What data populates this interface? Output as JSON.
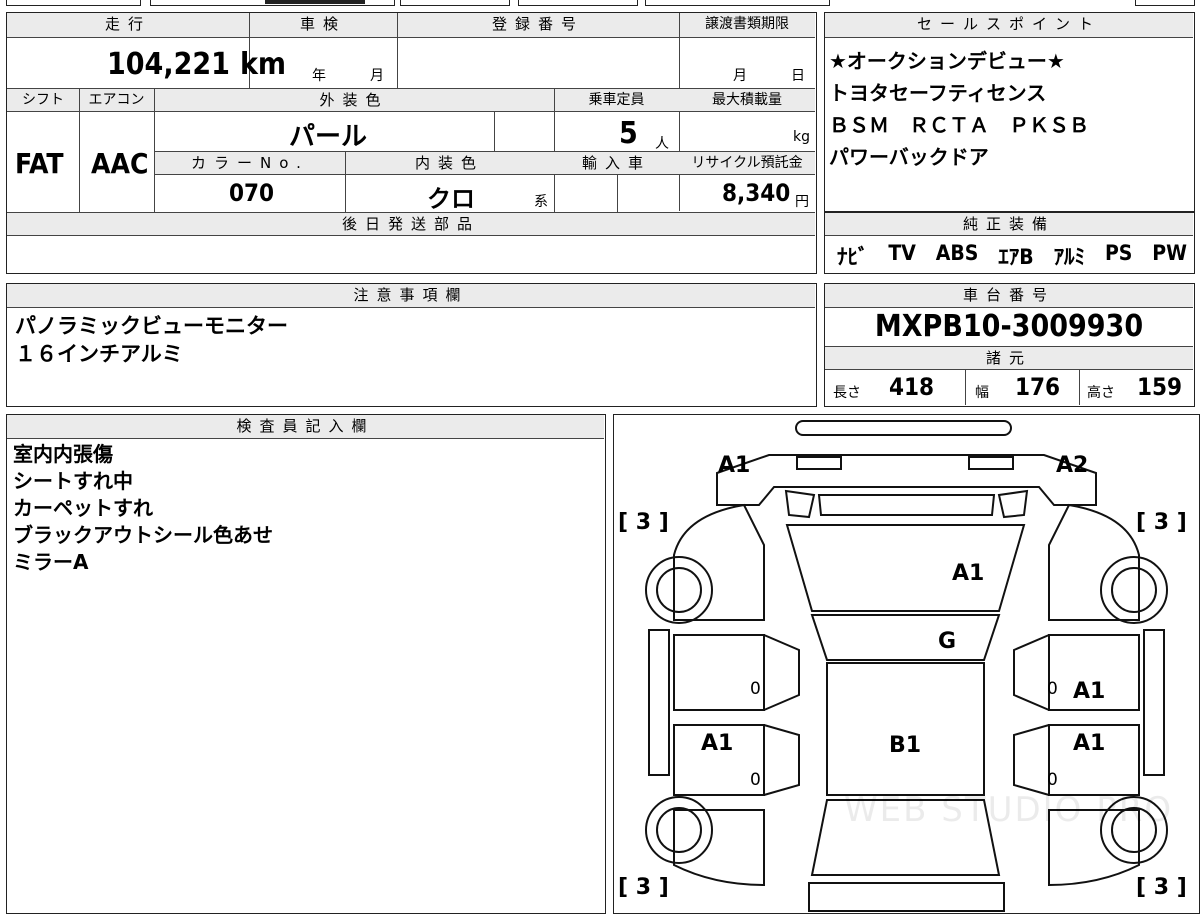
{
  "spec": {
    "mileage_label": "走行",
    "mileage_value": "104,221",
    "mileage_unit": "km",
    "inspection_label": "車検",
    "inspection_year": "年",
    "inspection_month": "月",
    "registration_label": "登録番号",
    "transfer_label": "譲渡書類期限",
    "transfer_month": "月",
    "transfer_day": "日",
    "shift_label": "シフト",
    "shift_value": "FAT",
    "ac_label": "エアコン",
    "ac_value": "AAC",
    "exterior_label": "外装色",
    "exterior_value": "パール",
    "capacity_label": "乗車定員",
    "capacity_value": "5",
    "capacity_unit": "人",
    "max_load_label": "最大積載量",
    "max_load_unit": "kg",
    "color_no_label": "カラーNo.",
    "color_no_value": "070",
    "interior_label": "内装色",
    "interior_value": "クロ",
    "interior_suffix": "系",
    "import_label": "輸入車",
    "recycle_label": "リサイクル預託金",
    "recycle_value": "8,340",
    "recycle_unit": "円",
    "later_parts_label": "後日発送部品"
  },
  "sales_points": {
    "label": "セールスポイント",
    "lines": [
      "★オークションデビュー★",
      "トヨタセーフティセンス",
      "ＢＳＭ　ＲＣＴＡ　ＰＫＳＢ",
      "パワーバックドア"
    ]
  },
  "equipment": {
    "label": "純正装備",
    "items": [
      "ﾅﾋﾞ",
      "TV",
      "ABS",
      "ｴｱB",
      "ｱﾙﾐ",
      "PS",
      "PW"
    ]
  },
  "notes": {
    "label": "注意事項欄",
    "lines": [
      "パノラミックビューモニター",
      "１６インチアルミ"
    ]
  },
  "chassis": {
    "label": "車台番号",
    "value": "MXPB10-3009930",
    "spec_label": "諸元",
    "length_label": "長さ",
    "length_value": "418",
    "width_label": "幅",
    "width_value": "176",
    "height_label": "高さ",
    "height_value": "159"
  },
  "inspector": {
    "label": "検査員記入欄",
    "lines": [
      "室内内張傷",
      "シートすれ中",
      "カーペットすれ",
      "ブラックアウトシール色あせ",
      "ミラーA"
    ]
  },
  "diagram": {
    "marks": [
      "A1",
      "A2",
      "A1",
      "G",
      "A1",
      "A1",
      "A1",
      "B1"
    ],
    "tires": [
      "3",
      "3",
      "3",
      "3"
    ],
    "zeros": [
      "0",
      "0",
      "0",
      "0"
    ],
    "watermark": "WEB STUDIO PRO"
  }
}
